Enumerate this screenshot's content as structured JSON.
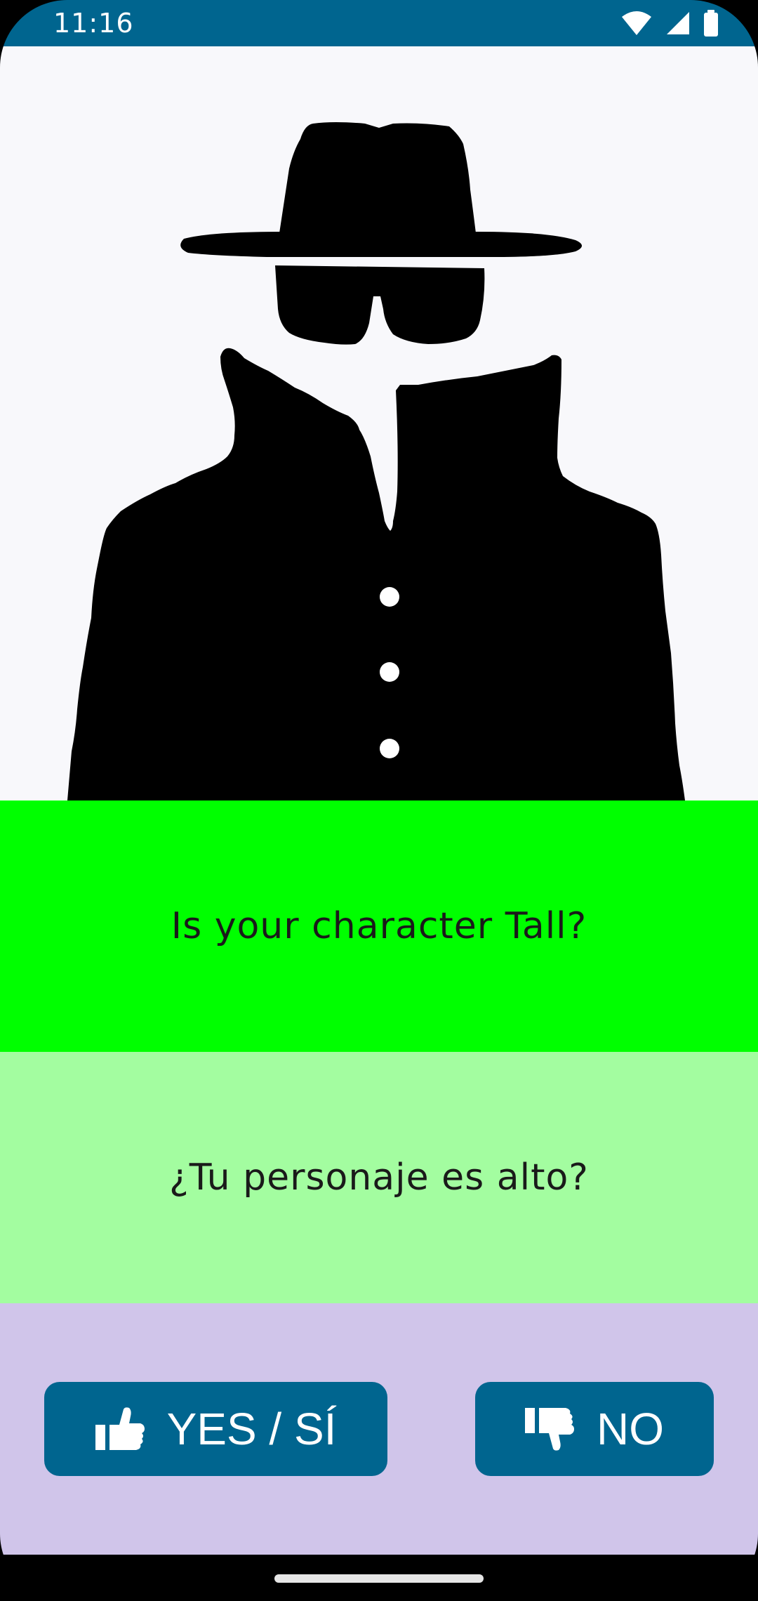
{
  "status_bar": {
    "time": "11:16",
    "icons": [
      "wifi-icon",
      "cell-signal-icon",
      "battery-icon"
    ]
  },
  "hero": {
    "image": "mystery-character-silhouette"
  },
  "question": {
    "english": "Is your character Tall?",
    "spanish": "¿Tu personaje es alto?"
  },
  "answers": {
    "yes_label": "YES / SÍ",
    "no_label": "NO",
    "yes_icon": "thumbs-up-icon",
    "no_icon": "thumbs-down-icon"
  },
  "colors": {
    "status_bar": "#00658f",
    "question_english_bg": "#00ff00",
    "question_spanish_bg": "#a3fda0",
    "answers_bg": "#d0c5ea",
    "button": "#00658f"
  }
}
